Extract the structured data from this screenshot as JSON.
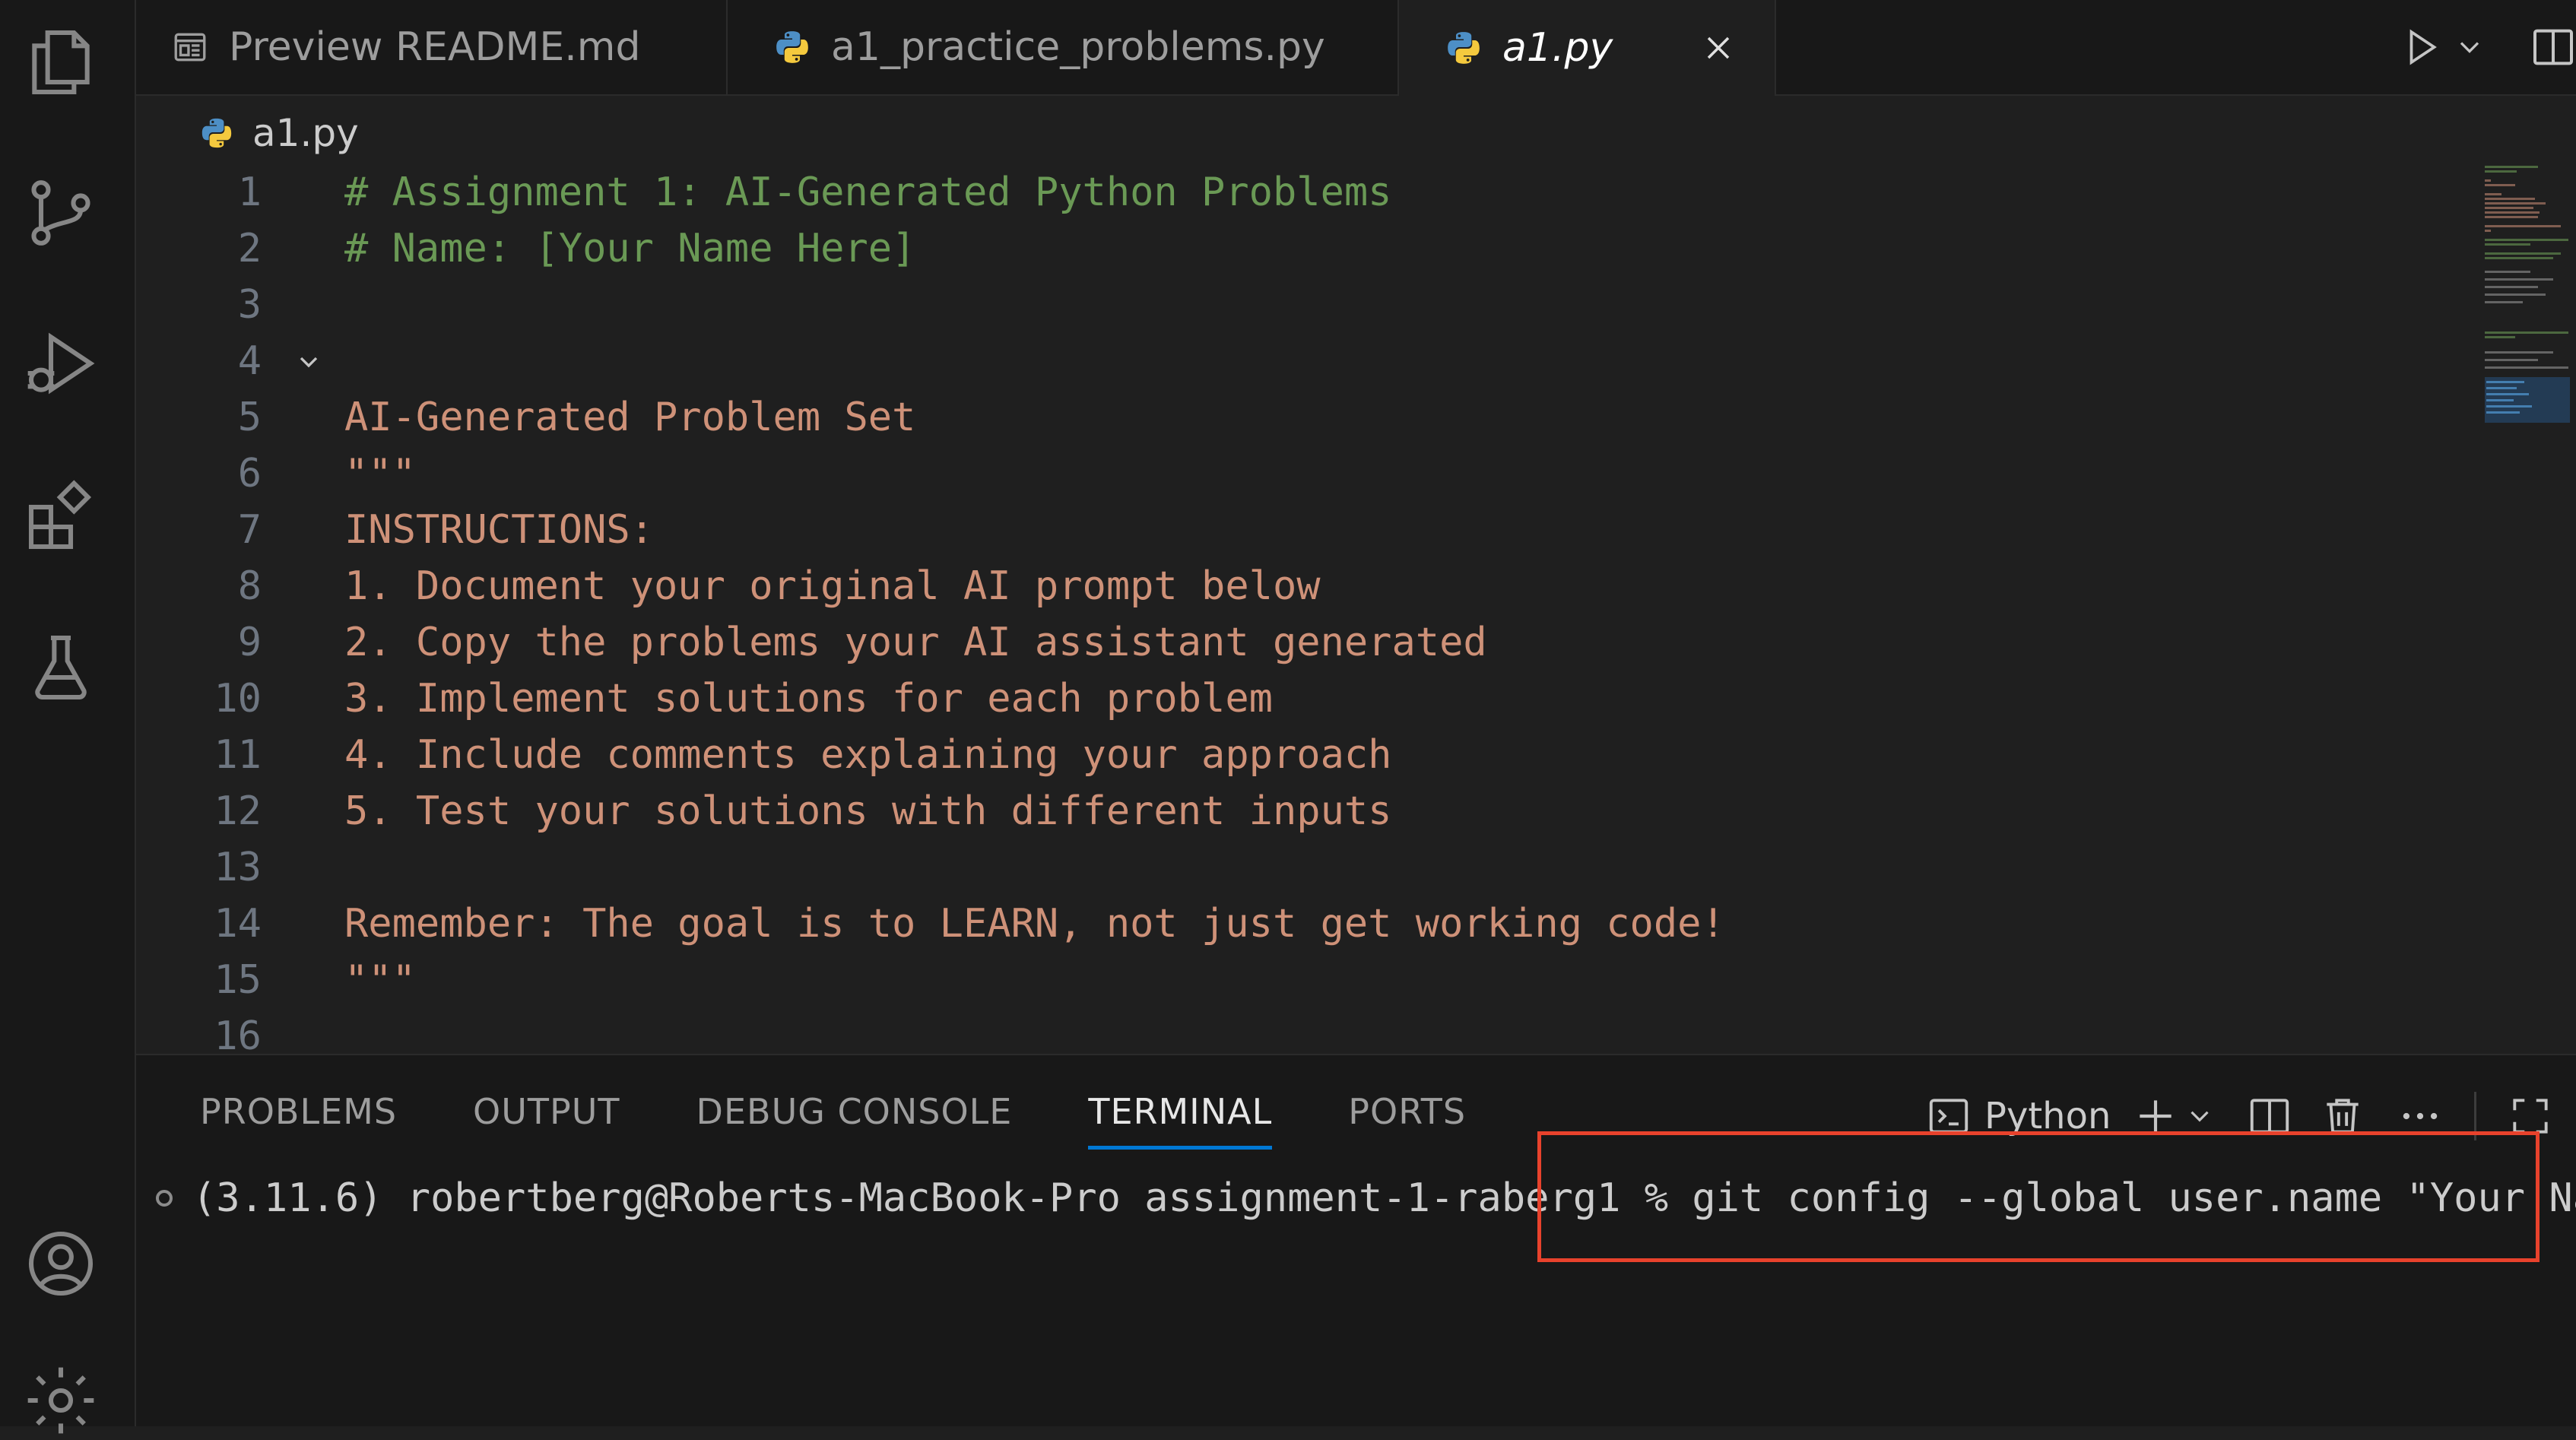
{
  "tabs": [
    {
      "label": "Preview README.md",
      "icon": "preview-icon"
    },
    {
      "label": "a1_practice_problems.py",
      "icon": "python-icon"
    },
    {
      "label": "a1.py",
      "icon": "python-icon",
      "active": true
    }
  ],
  "breadcrumb": {
    "file": "a1.py"
  },
  "editor": {
    "lines": [
      {
        "n": "1",
        "text": "# Assignment 1: AI-Generated Python Problems",
        "kind": "comment"
      },
      {
        "n": "2",
        "text": "# Name: [Your Name Here]",
        "kind": "comment"
      },
      {
        "n": "3",
        "text": "",
        "kind": "plain"
      },
      {
        "n": "4",
        "text": "\"\"\"",
        "kind": "string"
      },
      {
        "n": "5",
        "text": "AI-Generated Problem Set",
        "kind": "string"
      },
      {
        "n": "6",
        "text": "",
        "kind": "plain"
      },
      {
        "n": "7",
        "text": "INSTRUCTIONS:",
        "kind": "string"
      },
      {
        "n": "8",
        "text": "1. Document your original AI prompt below",
        "kind": "string"
      },
      {
        "n": "9",
        "text": "2. Copy the problems your AI assistant generated",
        "kind": "string"
      },
      {
        "n": "10",
        "text": "3. Implement solutions for each problem",
        "kind": "string"
      },
      {
        "n": "11",
        "text": "4. Include comments explaining your approach",
        "kind": "string"
      },
      {
        "n": "12",
        "text": "5. Test your solutions with different inputs",
        "kind": "string"
      },
      {
        "n": "13",
        "text": "",
        "kind": "plain"
      },
      {
        "n": "14",
        "text": "Remember: The goal is to LEARN, not just get working code!",
        "kind": "string"
      },
      {
        "n": "15",
        "text": "\"\"\"",
        "kind": "string"
      },
      {
        "n": "16",
        "text": "",
        "kind": "plain"
      }
    ]
  },
  "panel": {
    "tabs": [
      "PROBLEMS",
      "OUTPUT",
      "DEBUG CONSOLE",
      "TERMINAL",
      "PORTS"
    ],
    "active_tab": "TERMINAL",
    "terminal_profile": "Python"
  },
  "terminal": {
    "prompt": "(3.11.6) robertberg@Roberts-MacBook-Pro assignment-1-raberg1 %",
    "command": " git config --global user.name \"Your Name\""
  },
  "colors": {
    "accent": "#0078d4",
    "highlight_box": "#e8422c",
    "comment": "#6a9955",
    "string": "#ce9178"
  }
}
